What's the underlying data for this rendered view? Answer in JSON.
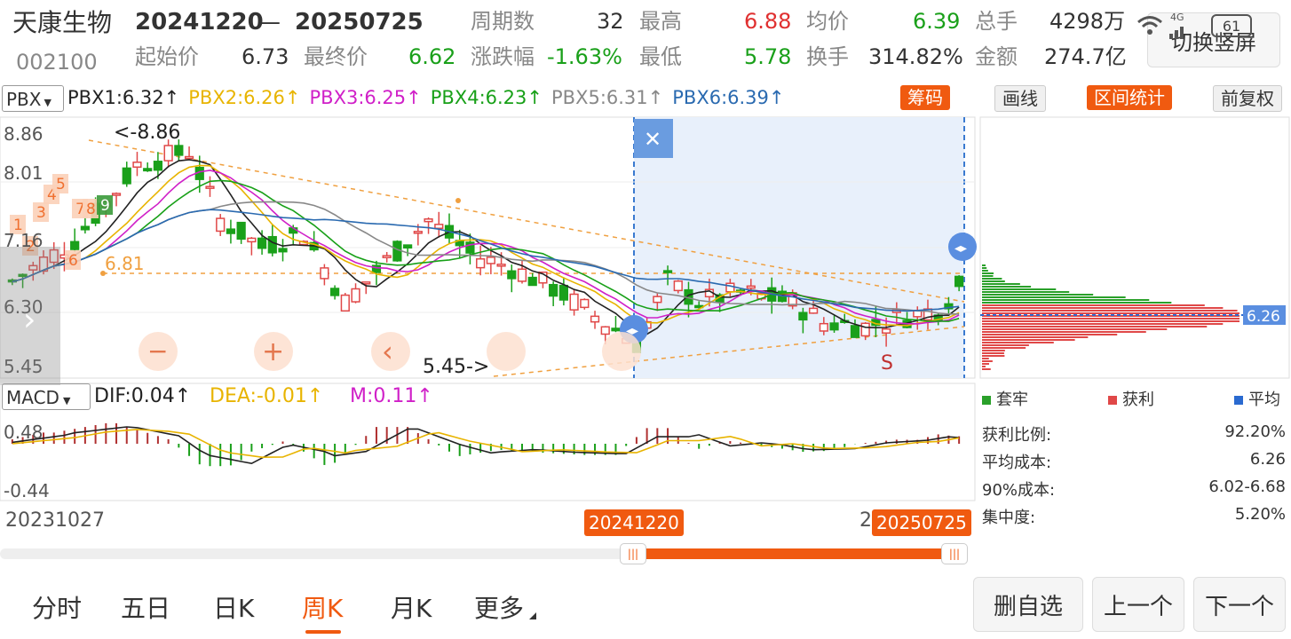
{
  "header": {
    "stock_name": "天康生物",
    "stock_code": "002100",
    "date_range_start": "20241220",
    "date_range_sep": "—",
    "date_range_end": "20250725",
    "stats": [
      {
        "label": "周期数",
        "value": "32",
        "color": "#333333"
      },
      {
        "label": "最高",
        "value": "6.88",
        "color": "#e03030"
      },
      {
        "label": "均价",
        "value": "6.39",
        "color": "#1aa01a"
      },
      {
        "label": "总手",
        "value": "4298万",
        "color": "#333333"
      },
      {
        "label": "起始价",
        "value": "6.73",
        "color": "#333333"
      },
      {
        "label": "最终价",
        "value": "6.62",
        "color": "#1aa01a"
      },
      {
        "label": "涨跌幅",
        "value": "-1.63%",
        "color": "#1aa01a"
      },
      {
        "label": "最低",
        "value": "5.78",
        "color": "#1aa01a"
      },
      {
        "label": "换手",
        "value": "314.82%",
        "color": "#333333"
      },
      {
        "label": "金额",
        "value": "274.7亿",
        "color": "#333333"
      }
    ],
    "switch_button": "切换竖屏",
    "status": {
      "signal": "4G",
      "battery": "61"
    }
  },
  "indicators": {
    "selector": "PBX",
    "items": [
      {
        "label": "PBX1:6.32",
        "arrow": "↑",
        "color": "#222222"
      },
      {
        "label": "PBX2:6.26",
        "arrow": "↑",
        "color": "#e8b400"
      },
      {
        "label": "PBX3:6.25",
        "arrow": "↑",
        "color": "#d020c8"
      },
      {
        "label": "PBX4:6.23",
        "arrow": "↑",
        "color": "#18a018"
      },
      {
        "label": "PBX5:6.31",
        "arrow": "↑",
        "color": "#888888"
      },
      {
        "label": "PBX6:6.39",
        "arrow": "↑",
        "color": "#2a6ab0"
      }
    ],
    "chip_button": "筹码",
    "draw_button": "画线",
    "range_stats_button": "区间统计",
    "adjust_button": "前复权"
  },
  "price_chart": {
    "y_labels": [
      "8.86",
      "8.01",
      "7.16",
      "6.30",
      "5.45"
    ],
    "high_note": "<-8.86",
    "low_note": "5.45->",
    "level_label": "6.81",
    "seq_labels": [
      "1",
      "2",
      "3",
      "4",
      "5",
      "6",
      "7",
      "8",
      "9"
    ],
    "signal_label": "S",
    "close_icon": "✕",
    "zoom_out": "−",
    "zoom_in": "+",
    "prev": "‹",
    "next": "›"
  },
  "macd": {
    "selector": "MACD",
    "dif": "DIF:0.04",
    "dea": "DEA:-0.01",
    "m": "M:0.11",
    "arrow": "↑",
    "y_top": "0.48",
    "y_bottom": "-0.44"
  },
  "timeline": {
    "start_date": "20231027",
    "sel_start": "20241220",
    "sel_end": "20250725",
    "partial_char": "2"
  },
  "chip_panel": {
    "price_tag": "6.26",
    "legend": [
      {
        "label": "套牢",
        "color": "#2aa02a"
      },
      {
        "label": "获利",
        "color": "#e04848"
      },
      {
        "label": "平均",
        "color": "#2a6ad0"
      }
    ],
    "stats": [
      {
        "label": "获利比例:",
        "value": "92.20%"
      },
      {
        "label": "平均成本:",
        "value": "6.26"
      },
      {
        "label": "90%成本:",
        "value": "6.02-6.68"
      },
      {
        "label": "集中度:",
        "value": "5.20%"
      }
    ]
  },
  "bottom_tabs": [
    {
      "label": "分时",
      "active": false
    },
    {
      "label": "五日",
      "active": false
    },
    {
      "label": "日K",
      "active": false
    },
    {
      "label": "周K",
      "active": true
    },
    {
      "label": "月K",
      "active": false
    },
    {
      "label": "更多",
      "active": false
    }
  ],
  "bottom_buttons": {
    "remove": "删自选",
    "prev": "上一个",
    "next": "下一个"
  },
  "colors": {
    "up": "#e04848",
    "down": "#1aa01a",
    "accent": "#f05a10",
    "selection": "#e8f0fb"
  }
}
